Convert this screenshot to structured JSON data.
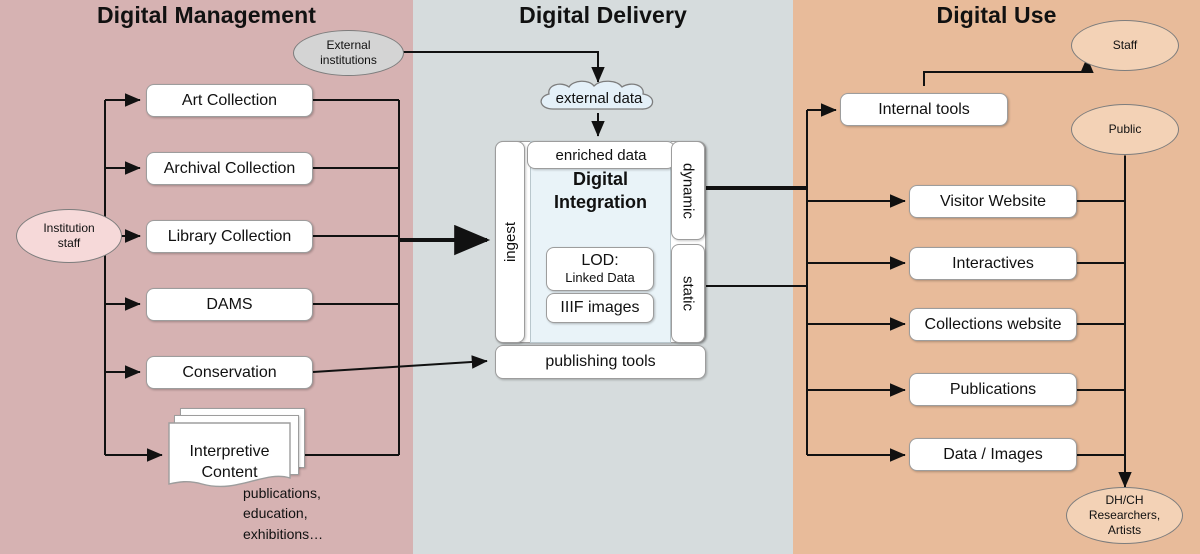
{
  "panels": [
    {
      "id": "digital-management",
      "title": "Digital Management",
      "color": "#d6b2b2"
    },
    {
      "id": "digital-delivery",
      "title": "Digital Delivery",
      "color": "#d6dcdd"
    },
    {
      "id": "digital-use",
      "title": "Digital Use",
      "color": "#e8bb9a"
    }
  ],
  "left": {
    "actor": "Institution\nstaff",
    "actor_line1": "Institution",
    "actor_line2": "staff",
    "external_line1": "External",
    "external_line2": "institutions",
    "systems": [
      {
        "label": "Art Collection"
      },
      {
        "label": "Archival Collection"
      },
      {
        "label": "Library Collection"
      },
      {
        "label": "DAMS"
      },
      {
        "label": "Conservation"
      }
    ],
    "interpretive": {
      "line1": "Interpretive",
      "line2": "Content",
      "note_line1": "publications,",
      "note_line2": "education,",
      "note_line3": "exhibitions…"
    }
  },
  "center": {
    "cloud": "external data",
    "enriched": "enriched data",
    "ingest": "ingest",
    "dynamic": "dynamic",
    "static": "static",
    "integration_line1": "Digital",
    "integration_line2": "Integration",
    "lod_line1": "LOD:",
    "lod_line2": "Linked Data",
    "iiif": "IIIF  images",
    "publishing": "publishing tools"
  },
  "right": {
    "outputs": [
      {
        "label": "Internal tools"
      },
      {
        "label": "Visitor Website"
      },
      {
        "label": "Interactives"
      },
      {
        "label": "Collections website"
      },
      {
        "label": "Publications"
      },
      {
        "label": "Data / Images"
      }
    ],
    "audiences": [
      {
        "label": "Staff"
      },
      {
        "label": "Public"
      },
      {
        "line1": "DH/CH",
        "line2": "Researchers,",
        "line3": "Artists"
      }
    ]
  },
  "chart_data": {
    "type": "diagram",
    "title": "Digital Management → Digital Delivery → Digital Use",
    "nodes": [
      "Institution staff",
      "External institutions",
      "Art Collection",
      "Archival Collection",
      "Library Collection",
      "DAMS",
      "Conservation",
      "Interpretive Content",
      "external data",
      "enriched data",
      "ingest",
      "Digital Integration",
      "LOD: Linked Data",
      "IIIF  images",
      "dynamic",
      "static",
      "publishing tools",
      "Internal tools",
      "Visitor Website",
      "Interactives",
      "Collections website",
      "Publications",
      "Data / Images",
      "Staff",
      "Public",
      "DH/CH Researchers, Artists"
    ]
  }
}
